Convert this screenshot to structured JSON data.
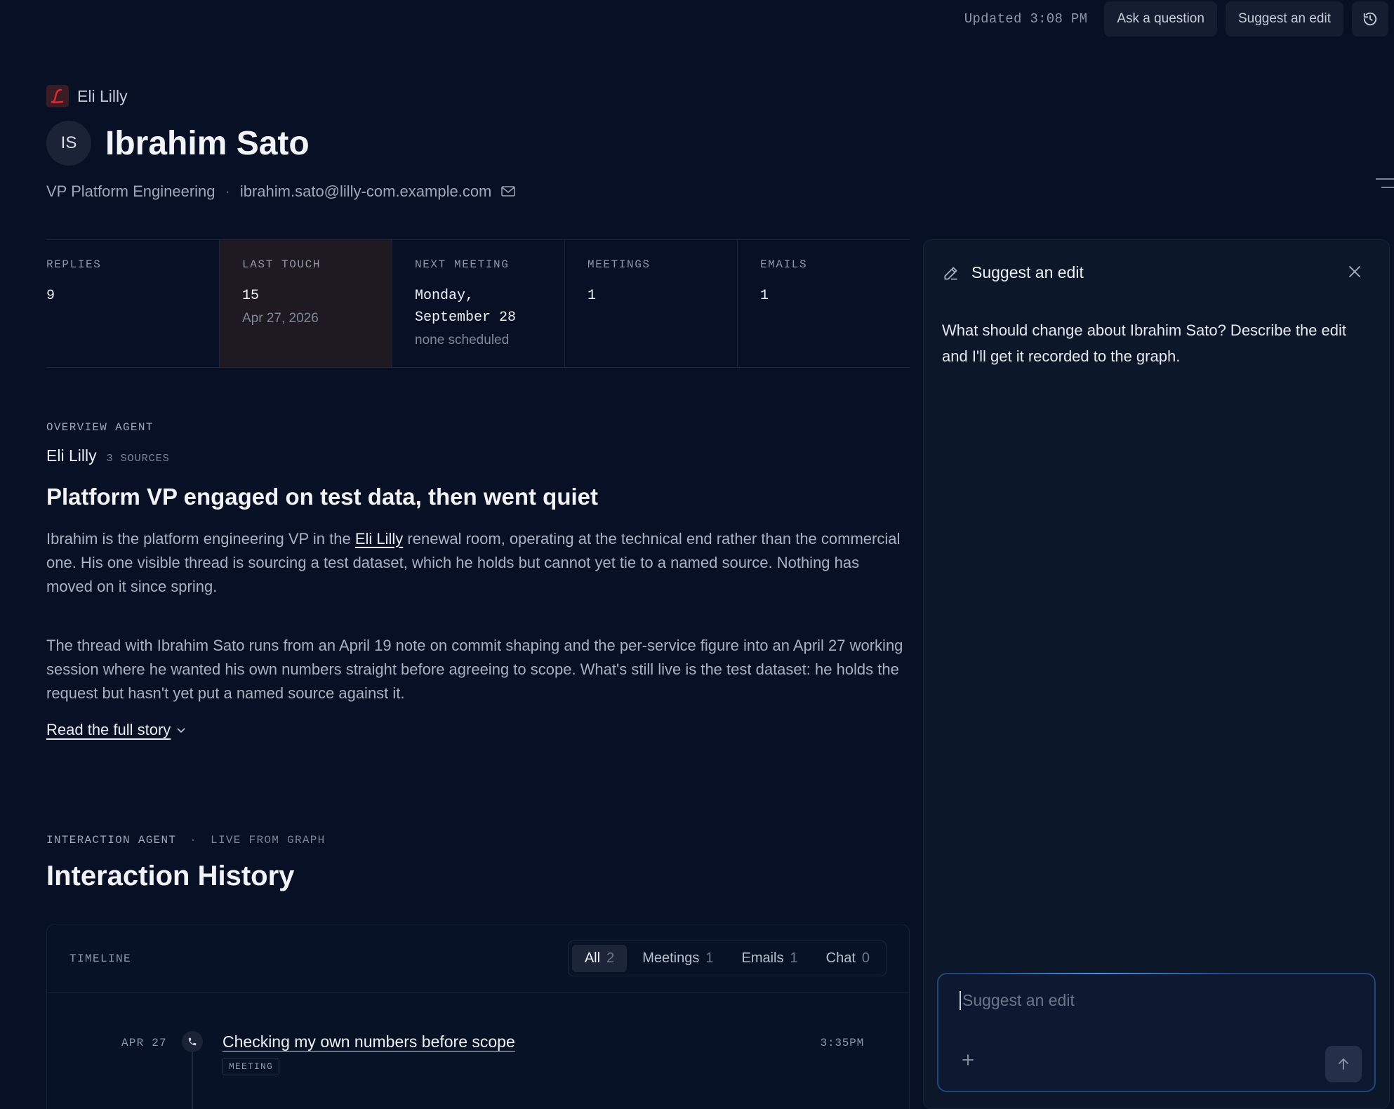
{
  "topbar": {
    "updated": "Updated 3:08 PM",
    "ask_label": "Ask a question",
    "suggest_label": "Suggest an edit",
    "history_icon": "history-icon"
  },
  "header": {
    "company": "Eli Lilly",
    "initials": "IS",
    "name": "Ibrahim Sato",
    "title": "VP Platform Engineering",
    "separator": "·",
    "email": "ibrahim.sato@lilly-com.example.com"
  },
  "stats": [
    {
      "label": "REPLIES",
      "value": "9",
      "sub": ""
    },
    {
      "label": "LAST TOUCH",
      "value": "15",
      "sub": "Apr 27, 2026"
    },
    {
      "label": "NEXT MEETING",
      "value": "Monday, September 28",
      "sub": "none scheduled"
    },
    {
      "label": "MEETINGS",
      "value": "1",
      "sub": ""
    },
    {
      "label": "EMAILS",
      "value": "1",
      "sub": ""
    }
  ],
  "overview": {
    "eyebrow": "OVERVIEW AGENT",
    "company": "Eli Lilly",
    "sources": "3 SOURCES",
    "headline": "Platform VP engaged on test data, then went quiet",
    "p1_before": "Ibrahim is the platform engineering VP in the ",
    "p1_link": "Eli Lilly",
    "p1_after": " renewal room, operating at the technical end rather than the commercial one. His one visible thread is sourcing a test dataset, which he holds but cannot yet tie to a named source. Nothing has moved on it since spring.",
    "p2": "The thread with Ibrahim Sato runs from an April 19 note on commit shaping and the per-service figure into an April 27 working session where he wanted his own numbers straight before agreeing to scope. What's still live is the test dataset: he holds the request but hasn't yet put a named source against it.",
    "read_more": "Read the full story"
  },
  "interaction": {
    "eyebrow_a": "INTERACTION AGENT",
    "eyebrow_sep": "·",
    "eyebrow_b": "LIVE FROM GRAPH",
    "title": "Interaction History",
    "timeline_label": "TIMELINE",
    "filters": [
      {
        "label": "All",
        "count": "2"
      },
      {
        "label": "Meetings",
        "count": "1"
      },
      {
        "label": "Emails",
        "count": "1"
      },
      {
        "label": "Chat",
        "count": "0"
      }
    ],
    "items": [
      {
        "date": "APR 27",
        "title": "Checking my own numbers before scope",
        "tag": "MEETING",
        "time": "3:35PM"
      }
    ]
  },
  "panel": {
    "title": "Suggest an edit",
    "body": "What should change about Ibrahim Sato? Describe the edit and I'll get it recorded to the graph.",
    "input_placeholder": "Suggest an edit"
  },
  "colors": {
    "background": "#071024",
    "accent": "#3b82f6",
    "highlight": "#1f1a22"
  }
}
